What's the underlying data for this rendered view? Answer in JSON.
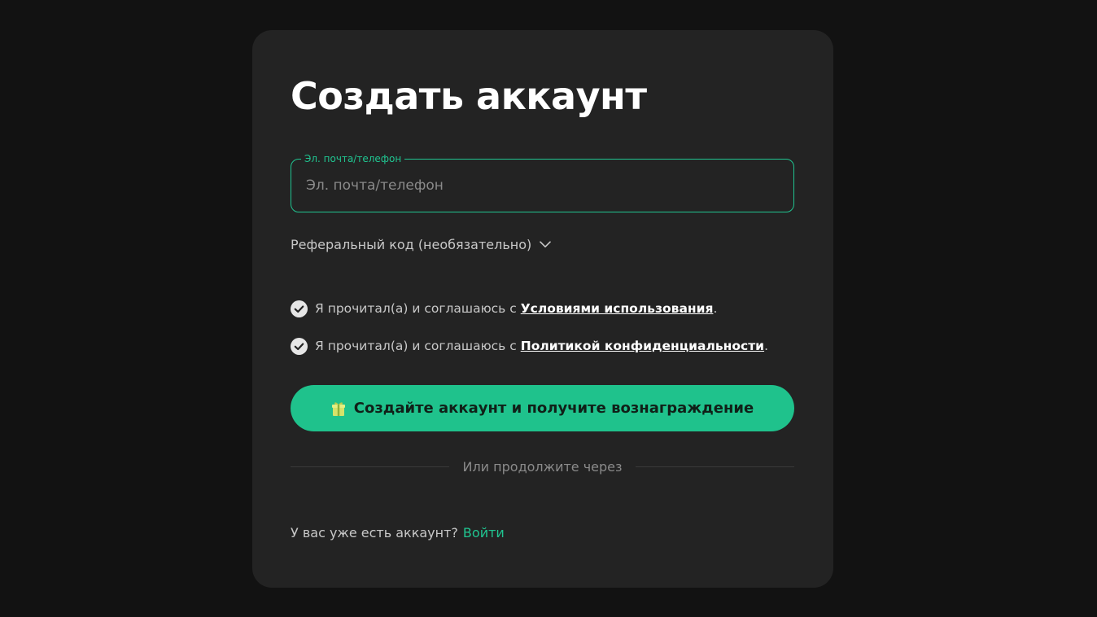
{
  "card": {
    "title": "Создать аккаунт"
  },
  "email_field": {
    "legend": "Эл. почта/телефон",
    "placeholder": "Эл. почта/телефон",
    "value": ""
  },
  "referral": {
    "label": "Реферальный код (необязательно)",
    "icon": "chevron-down-icon"
  },
  "agreements": [
    {
      "prefix": "Я прочитал(а) и соглашаюсь с",
      "link": "Условиями использования",
      "suffix": ".",
      "checked": true,
      "icon": "check-circle-icon"
    },
    {
      "prefix": "Я прочитал(а) и соглашаюсь с",
      "link": "Политикой конфиденциальности",
      "suffix": ".",
      "checked": true,
      "icon": "check-circle-icon"
    }
  ],
  "submit": {
    "label": "Создайте аккаунт и получите вознаграждение",
    "icon": "gift-icon"
  },
  "divider": {
    "text": "Или продолжите через"
  },
  "footer": {
    "question": "У вас уже есть аккаунт?",
    "login_link": "Войти"
  },
  "colors": {
    "background": "#121212",
    "card": "#232323",
    "accent": "#1fc28c",
    "text_primary": "#ffffff",
    "text_secondary": "#c8c8c8",
    "text_muted": "#8a8a8a"
  }
}
